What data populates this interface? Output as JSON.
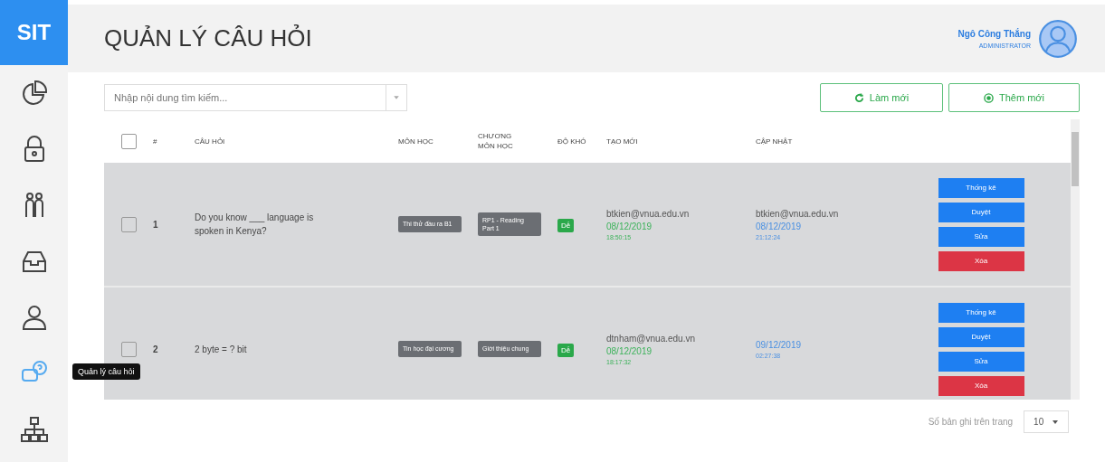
{
  "logo": "SIT",
  "page_title": "QUẢN LÝ CÂU HỎI",
  "user": {
    "name": "Ngô Công Thắng",
    "role": "ADMINISTRATOR"
  },
  "sidebar": {
    "items": [
      {
        "kind": "chart",
        "selected": false
      },
      {
        "kind": "lock",
        "selected": false
      },
      {
        "kind": "people",
        "selected": false
      },
      {
        "kind": "inbox",
        "selected": false
      },
      {
        "kind": "user",
        "selected": false
      },
      {
        "kind": "question",
        "selected": true
      },
      {
        "kind": "tree",
        "selected": false
      }
    ],
    "tooltip": "Quản lý câu hỏi"
  },
  "search": {
    "placeholder": "Nhập nội dung tìm kiếm..."
  },
  "toolbar_buttons": [
    {
      "kind": "refresh",
      "label": "Làm mới"
    },
    {
      "kind": "add",
      "label": "Thêm mới"
    }
  ],
  "table": {
    "columns": [
      "#",
      "CÂU HỎI",
      "MÔN HỌC",
      "CHƯƠNG MÔN HỌC",
      "ĐỘ KHÓ",
      "TẠO MỚI",
      "CẬP NHẬT"
    ],
    "header_checked": false,
    "rows": [
      {
        "checked": false,
        "index": "1",
        "question": "Do you know ___ language is spoken in Kenya?",
        "subject": "Thi thử đầu ra B1",
        "chapter": "RP1 - Reading Part 1",
        "difficulty": "Dễ",
        "created": {
          "by": "btkien@vnua.edu.vn",
          "date": "08/12/2019",
          "time": "18:50:15"
        },
        "updated": {
          "by": "btkien@vnua.edu.vn",
          "date": "08/12/2019",
          "time": "21:12:24"
        },
        "actions": [
          {
            "kind": "primary",
            "label": "Thống kê"
          },
          {
            "kind": "primary",
            "label": "Duyệt"
          },
          {
            "kind": "primary",
            "label": "Sửa"
          },
          {
            "kind": "danger",
            "label": "Xóa"
          }
        ]
      },
      {
        "checked": false,
        "index": "2",
        "question": "2 byte = ? bit",
        "subject": "Tin học đại cương",
        "chapter": "Giới thiệu chung",
        "difficulty": "Dễ",
        "created": {
          "by": "dtnham@vnua.edu.vn",
          "date": "08/12/2019",
          "time": "18:17:32"
        },
        "updated": {
          "date": "09/12/2019",
          "time": "02:27:38"
        },
        "actions": [
          {
            "kind": "primary",
            "label": "Thống kê"
          },
          {
            "kind": "primary",
            "label": "Duyệt"
          },
          {
            "kind": "primary",
            "label": "Sửa"
          },
          {
            "kind": "danger",
            "label": "Xóa"
          }
        ]
      }
    ]
  },
  "footer": {
    "page_size_label": "Số bản ghi trên trang",
    "page_size": "10"
  }
}
